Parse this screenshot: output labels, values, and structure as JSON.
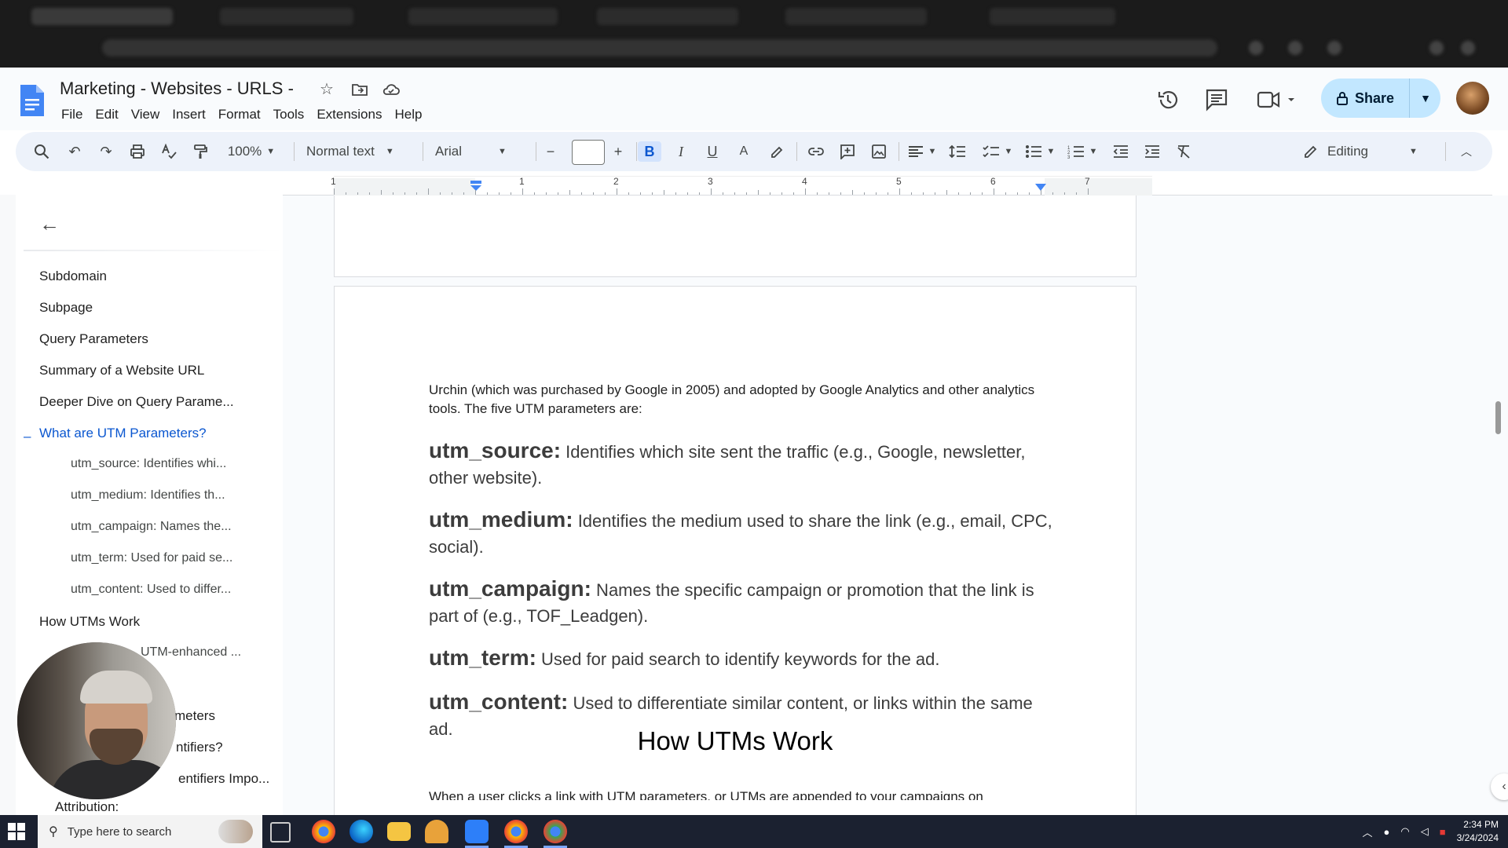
{
  "doc": {
    "title": "Marketing - Websites - URLS -",
    "menu": [
      "File",
      "Edit",
      "View",
      "Insert",
      "Format",
      "Tools",
      "Extensions",
      "Help"
    ]
  },
  "header": {
    "share_label": "Share",
    "icons": [
      "history-icon",
      "comments-icon",
      "meet-icon",
      "lock-icon",
      "avatar"
    ]
  },
  "toolbar": {
    "zoom": "100%",
    "style": "Normal text",
    "font": "Arial",
    "font_size": "",
    "mode": "Editing"
  },
  "ruler": {
    "labels": [
      "1",
      "1",
      "2",
      "3",
      "4",
      "5",
      "6",
      "7"
    ]
  },
  "outline": {
    "items": [
      {
        "label": "Subdomain",
        "level": 1
      },
      {
        "label": "Subpage",
        "level": 1
      },
      {
        "label": "Query Parameters",
        "level": 1
      },
      {
        "label": "Summary of a Website URL",
        "level": 1
      },
      {
        "label": "Deeper Dive on Query Parame...",
        "level": 1
      },
      {
        "label": "What are UTM Parameters?",
        "level": 1
      },
      {
        "label": "utm_source: Identifies whi...",
        "level": 2
      },
      {
        "label": "utm_medium: Identifies th...",
        "level": 2
      },
      {
        "label": "utm_campaign: Names the...",
        "level": 2
      },
      {
        "label": "utm_term: Used for paid se...",
        "level": 2
      },
      {
        "label": "utm_content: Used to differ...",
        "level": 2
      },
      {
        "label": "How UTMs Work",
        "level": 1
      },
      {
        "label": "UTM-enhanced ...",
        "level": 2
      },
      {
        "label": "meters",
        "level": 2
      },
      {
        "label": "ntifiers?",
        "level": 2
      },
      {
        "label": "entifiers Impo...",
        "level": 2
      },
      {
        "label": "Attribution:",
        "level": 2
      }
    ]
  },
  "document": {
    "intro": "Urchin (which was purchased by Google in 2005) and adopted by Google Analytics and other analytics tools. The five UTM parameters are:",
    "params": [
      {
        "name": "utm_source:",
        "desc": " Identifies which site sent the traffic (e.g., Google, newsletter, other website)."
      },
      {
        "name": "utm_medium:",
        "desc": " Identifies the medium used to share the link (e.g., email, CPC, social)."
      },
      {
        "name": "utm_campaign:",
        "desc": " Names the specific campaign or promotion that the link is part of (e.g., TOF_Leadgen)."
      },
      {
        "name": "utm_term:",
        "desc": " Used for paid search to identify keywords for the ad."
      },
      {
        "name": "utm_content:",
        "desc": " Used to differentiate similar content, or links within the same ad."
      }
    ],
    "heading": "How UTMs Work",
    "trailing": "When a user clicks a link with UTM parameters, or UTMs are appended to your campaigns on"
  },
  "taskbar": {
    "search_placeholder": "Type here to search",
    "time": "2:34 PM",
    "date": "3/24/2024"
  }
}
